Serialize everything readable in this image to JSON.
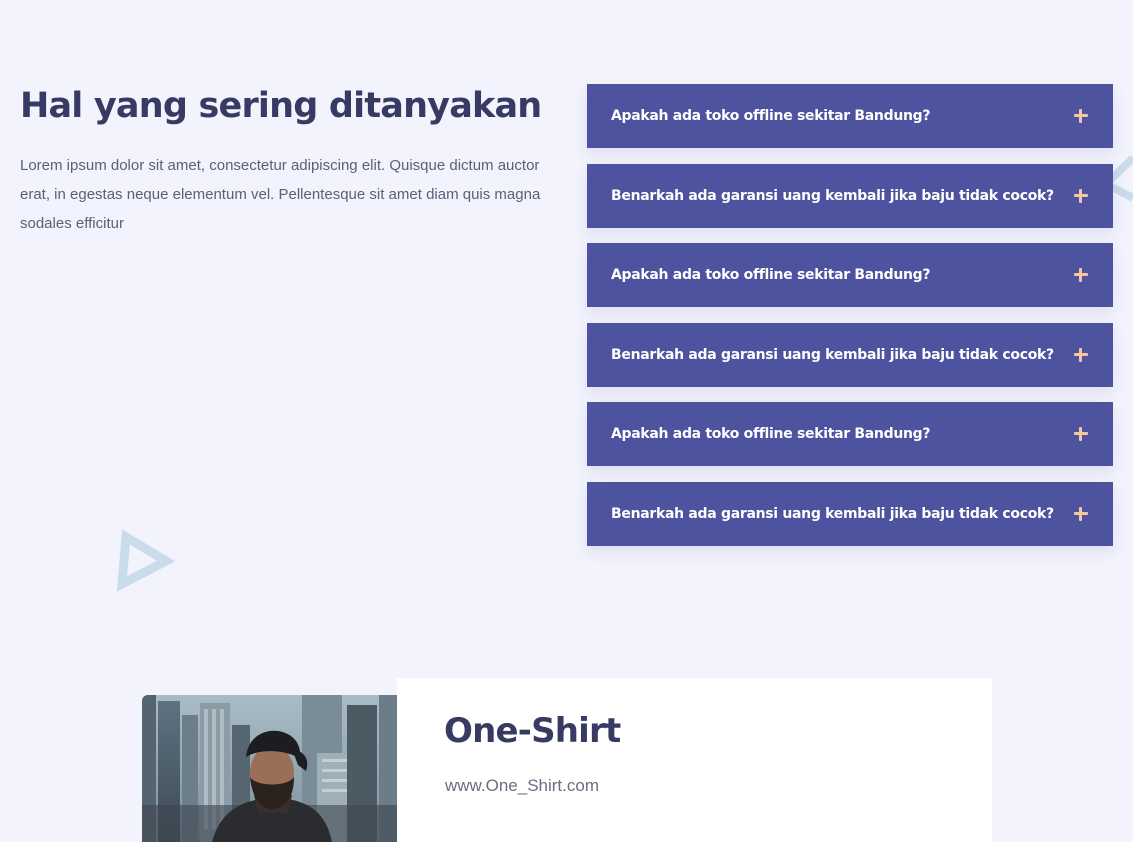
{
  "faq": {
    "title": "Hal yang sering ditanyakan",
    "description": "Lorem ipsum dolor sit amet, consectetur adipiscing elit. Quisque dictum auctor erat, in egestas neque elementum vel. Pellentesque sit amet diam quis magna sodales efficitur",
    "items": [
      {
        "question": "Apakah ada toko offline sekitar Bandung?",
        "icon": "plus-icon"
      },
      {
        "question": "Benarkah ada garansi uang kembali jika baju tidak cocok?",
        "icon": "plus-icon"
      },
      {
        "question": "Apakah ada toko offline sekitar Bandung?",
        "icon": "plus-icon"
      },
      {
        "question": "Benarkah ada garansi uang kembali jika baju tidak cocok?",
        "icon": "plus-icon"
      },
      {
        "question": "Apakah ada toko offline sekitar Bandung?",
        "icon": "plus-icon"
      },
      {
        "question": "Benarkah ada garansi uang kembali jika baju tidak cocok?",
        "icon": "plus-icon"
      }
    ]
  },
  "product": {
    "name": "One-Shirt",
    "url": "www.One_Shirt.com",
    "image": "man-with-cap-city-photo"
  },
  "colors": {
    "background": "#f3f3fd",
    "accordion": "#4e539f",
    "heading": "#373a63",
    "accent": "#f3c7a0",
    "decoration": "#c9dceb"
  }
}
